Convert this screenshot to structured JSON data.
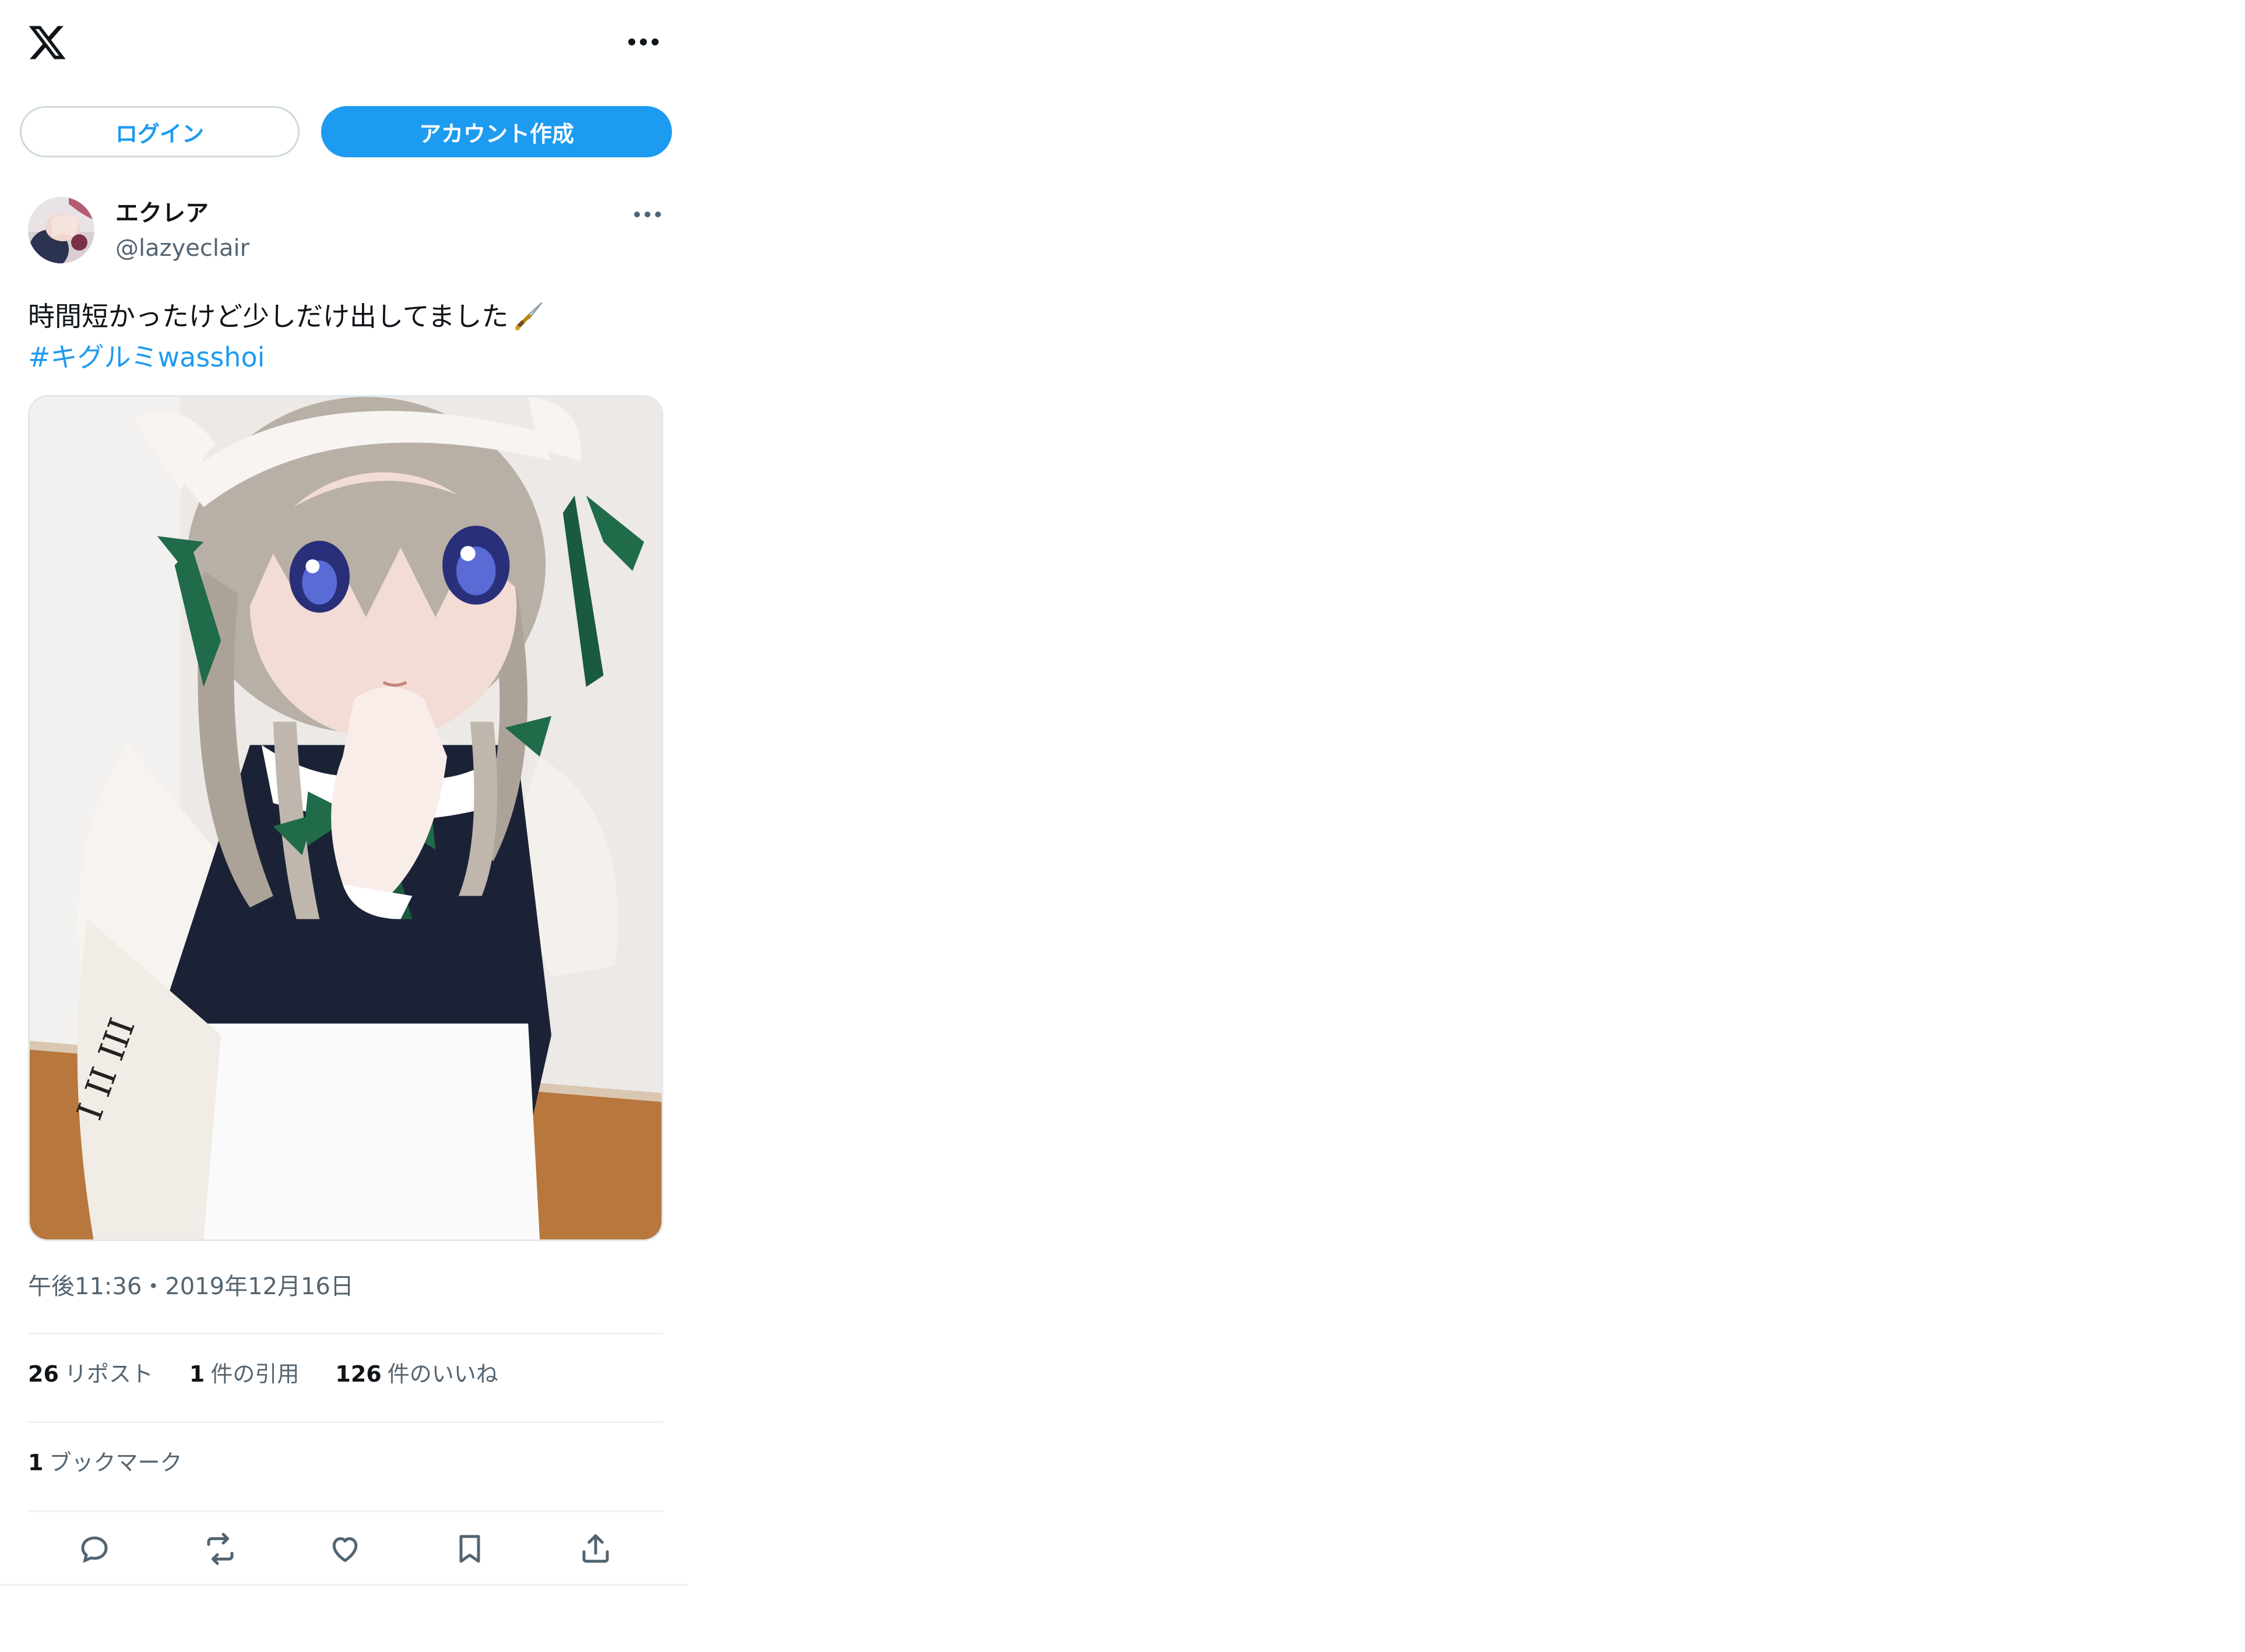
{
  "header": {
    "logo_icon": "x-logo-icon",
    "more_icon": "more-horizontal-icon"
  },
  "auth": {
    "login_label": "ログイン",
    "signup_label": "アカウント作成",
    "accent_color": "#1d9bf0"
  },
  "post": {
    "author": {
      "display_name": "エクレア",
      "handle": "@lazyeclair"
    },
    "text_line1": "時間短かったけど少しだけ出してました",
    "text_emoji_icon": "dagger-icon",
    "hashtag": "#キグルミwasshoi",
    "media_image": "photo of a person in a maid costume with an anime-style kigurumi mask",
    "timestamp": "午後11:36・2019年12月16日",
    "stats": {
      "reposts_count": "26",
      "reposts_label": "リポスト",
      "quotes_count": "1",
      "quotes_label": "件の引用",
      "likes_count": "126",
      "likes_label": "件のいいね"
    },
    "bookmarks": {
      "count": "1",
      "label": "ブックマーク"
    },
    "actions": [
      "reply-icon",
      "repost-icon",
      "like-icon",
      "bookmark-icon",
      "share-icon"
    ]
  }
}
